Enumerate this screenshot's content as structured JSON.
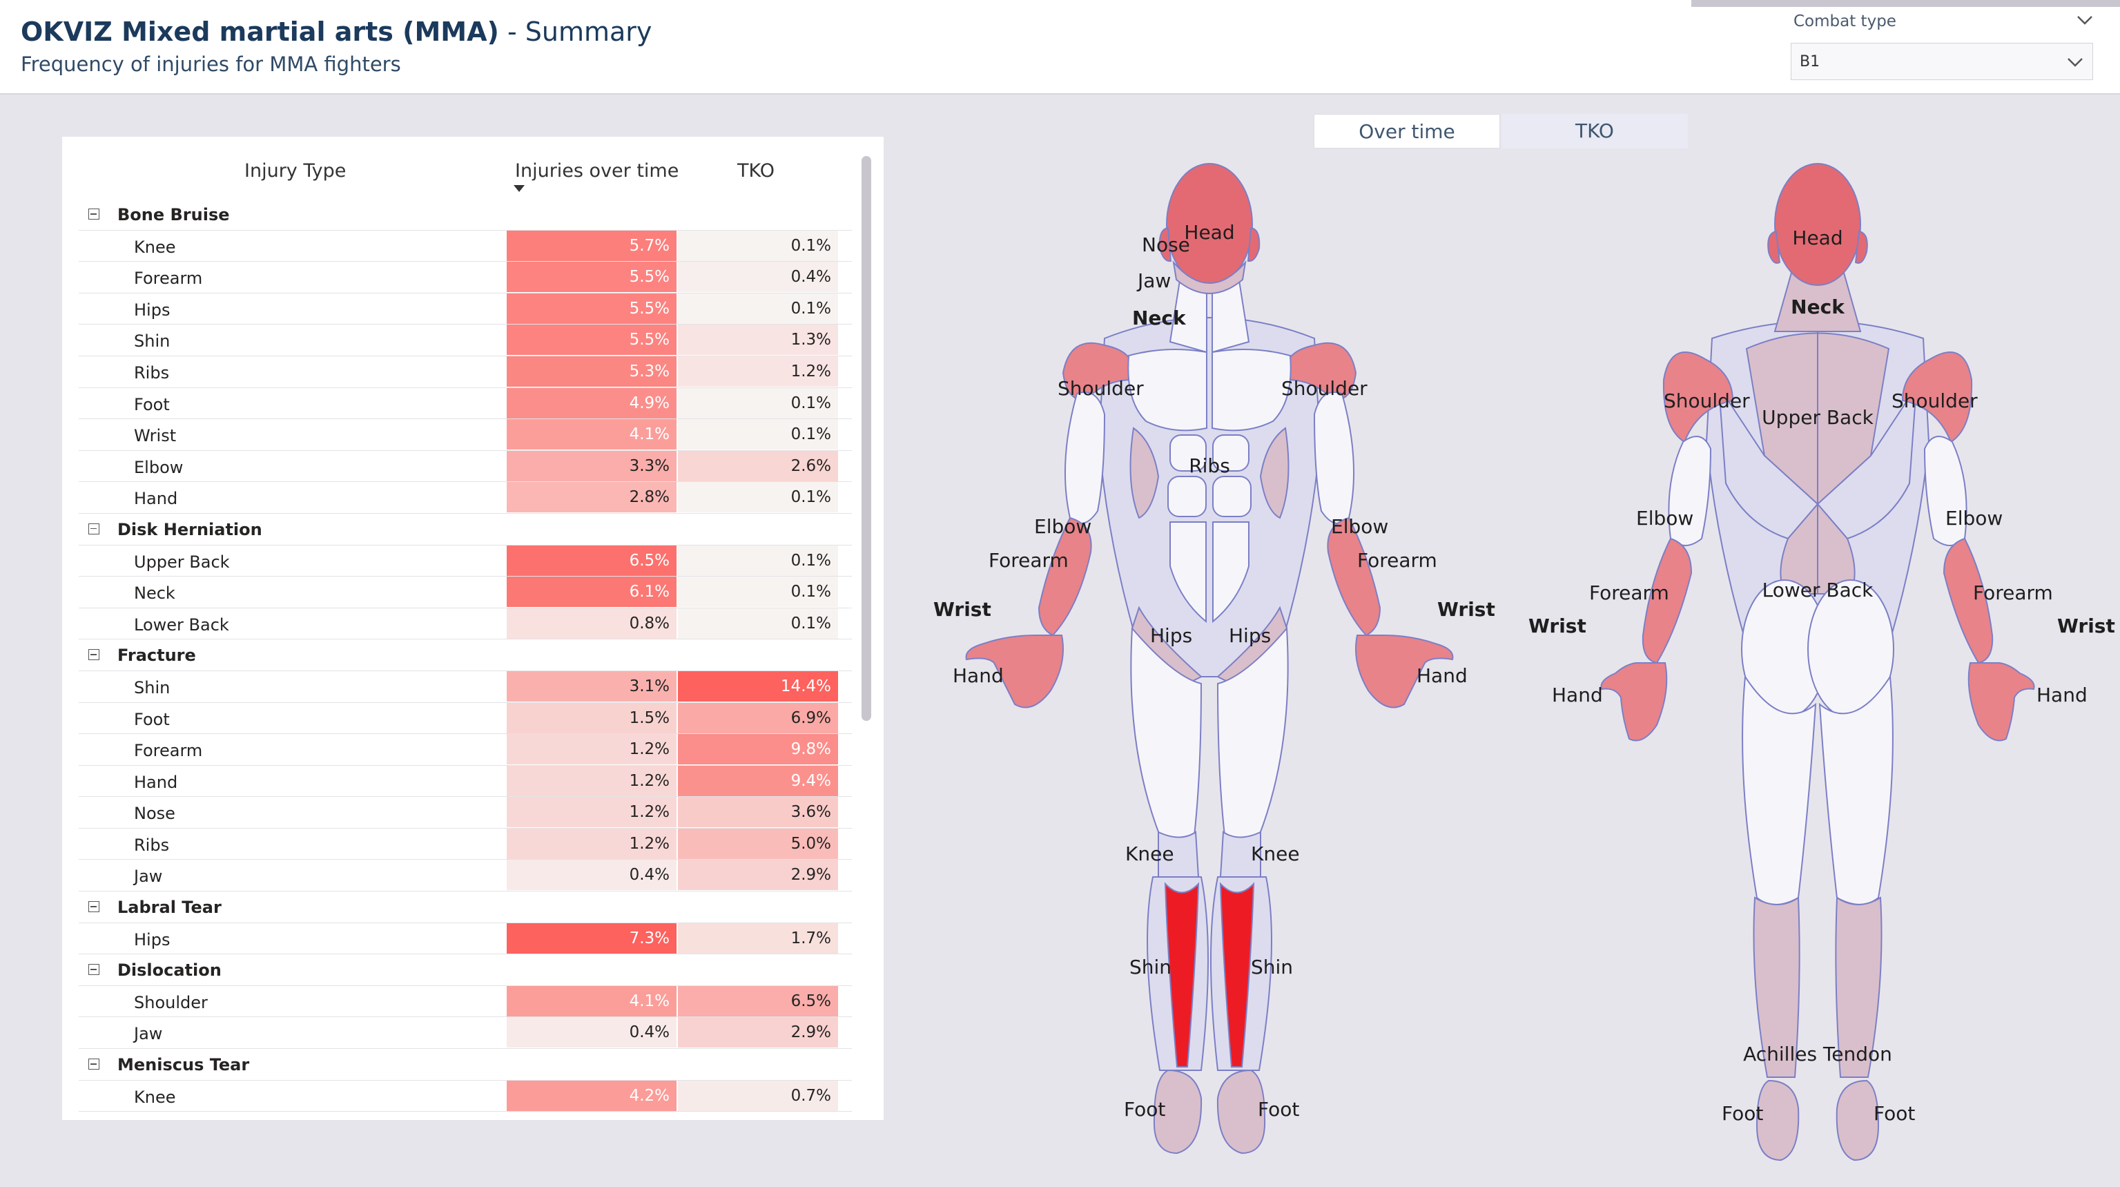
{
  "header": {
    "title": "OKVIZ Mixed martial arts (MMA)",
    "title_suffix": "- Summary",
    "subtitle": "Frequency of injuries for MMA fighters"
  },
  "filter": {
    "label": "Combat type",
    "value": "B1"
  },
  "table": {
    "columns": [
      "Injury Type",
      "Injuries over time",
      "TKO"
    ],
    "groups": [
      {
        "name": "Bone Bruise",
        "items": [
          {
            "label": "Knee",
            "over_time": "5.7%",
            "tko": "0.1%"
          },
          {
            "label": "Forearm",
            "over_time": "5.5%",
            "tko": "0.4%"
          },
          {
            "label": "Hips",
            "over_time": "5.5%",
            "tko": "0.1%"
          },
          {
            "label": "Shin",
            "over_time": "5.5%",
            "tko": "1.3%"
          },
          {
            "label": "Ribs",
            "over_time": "5.3%",
            "tko": "1.2%"
          },
          {
            "label": "Foot",
            "over_time": "4.9%",
            "tko": "0.1%"
          },
          {
            "label": "Wrist",
            "over_time": "4.1%",
            "tko": "0.1%"
          },
          {
            "label": "Elbow",
            "over_time": "3.3%",
            "tko": "2.6%"
          },
          {
            "label": "Hand",
            "over_time": "2.8%",
            "tko": "0.1%"
          }
        ]
      },
      {
        "name": "Disk Herniation",
        "items": [
          {
            "label": "Upper Back",
            "over_time": "6.5%",
            "tko": "0.1%"
          },
          {
            "label": "Neck",
            "over_time": "6.1%",
            "tko": "0.1%"
          },
          {
            "label": "Lower Back",
            "over_time": "0.8%",
            "tko": "0.1%"
          }
        ]
      },
      {
        "name": "Fracture",
        "items": [
          {
            "label": "Shin",
            "over_time": "3.1%",
            "tko": "14.4%"
          },
          {
            "label": "Foot",
            "over_time": "1.5%",
            "tko": "6.9%"
          },
          {
            "label": "Forearm",
            "over_time": "1.2%",
            "tko": "9.8%"
          },
          {
            "label": "Hand",
            "over_time": "1.2%",
            "tko": "9.4%"
          },
          {
            "label": "Nose",
            "over_time": "1.2%",
            "tko": "3.6%"
          },
          {
            "label": "Ribs",
            "over_time": "1.2%",
            "tko": "5.0%"
          },
          {
            "label": "Jaw",
            "over_time": "0.4%",
            "tko": "2.9%"
          }
        ]
      },
      {
        "name": "Labral Tear",
        "items": [
          {
            "label": "Hips",
            "over_time": "7.3%",
            "tko": "1.7%"
          }
        ]
      },
      {
        "name": "Dislocation",
        "items": [
          {
            "label": "Shoulder",
            "over_time": "4.1%",
            "tko": "6.5%"
          },
          {
            "label": "Jaw",
            "over_time": "0.4%",
            "tko": "2.9%"
          }
        ]
      },
      {
        "name": "Meniscus Tear",
        "items": [
          {
            "label": "Knee",
            "over_time": "4.2%",
            "tko": "0.7%"
          }
        ]
      }
    ]
  },
  "tabs": [
    {
      "label": "Over time",
      "selected": false
    },
    {
      "label": "TKO",
      "selected": true
    }
  ],
  "front_labels": {
    "head": "Head",
    "nose": "Nose",
    "jaw": "Jaw",
    "neck": "Neck",
    "shoulder_l": "Shoulder",
    "shoulder_r": "Shoulder",
    "ribs": "Ribs",
    "elbow_l": "Elbow",
    "elbow_r": "Elbow",
    "forearm_l": "Forearm",
    "forearm_r": "Forearm",
    "wrist_l": "Wrist",
    "wrist_r": "Wrist",
    "hand_l": "Hand",
    "hand_r": "Hand",
    "hips_l": "Hips",
    "hips_r": "Hips",
    "knee_l": "Knee",
    "knee_r": "Knee",
    "shin_l": "Shin",
    "shin_r": "Shin",
    "foot_l": "Foot",
    "foot_r": "Foot"
  },
  "back_labels": {
    "head": "Head",
    "neck": "Neck",
    "shoulder_l": "Shoulder",
    "shoulder_r": "Shoulder",
    "upper_back": "Upper Back",
    "elbow_l": "Elbow",
    "elbow_r": "Elbow",
    "forearm_l": "Forearm",
    "forearm_r": "Forearm",
    "lower_back": "Lower Back",
    "wrist_l": "Wrist",
    "wrist_r": "Wrist",
    "hand_l": "Hand",
    "hand_r": "Hand",
    "achilles": "Achilles Tendon",
    "foot_l": "Foot",
    "foot_r": "Foot"
  },
  "colors": {
    "accent": "#fd625e",
    "body_fill": "#f6f5fa",
    "body_stroke": "#7b7fc6",
    "muscle_shade": "#dcdcee",
    "highlight_mid": "#e8838a",
    "highlight_strong": "#ed1c24",
    "highlight_soft": "#d9bfcb"
  }
}
